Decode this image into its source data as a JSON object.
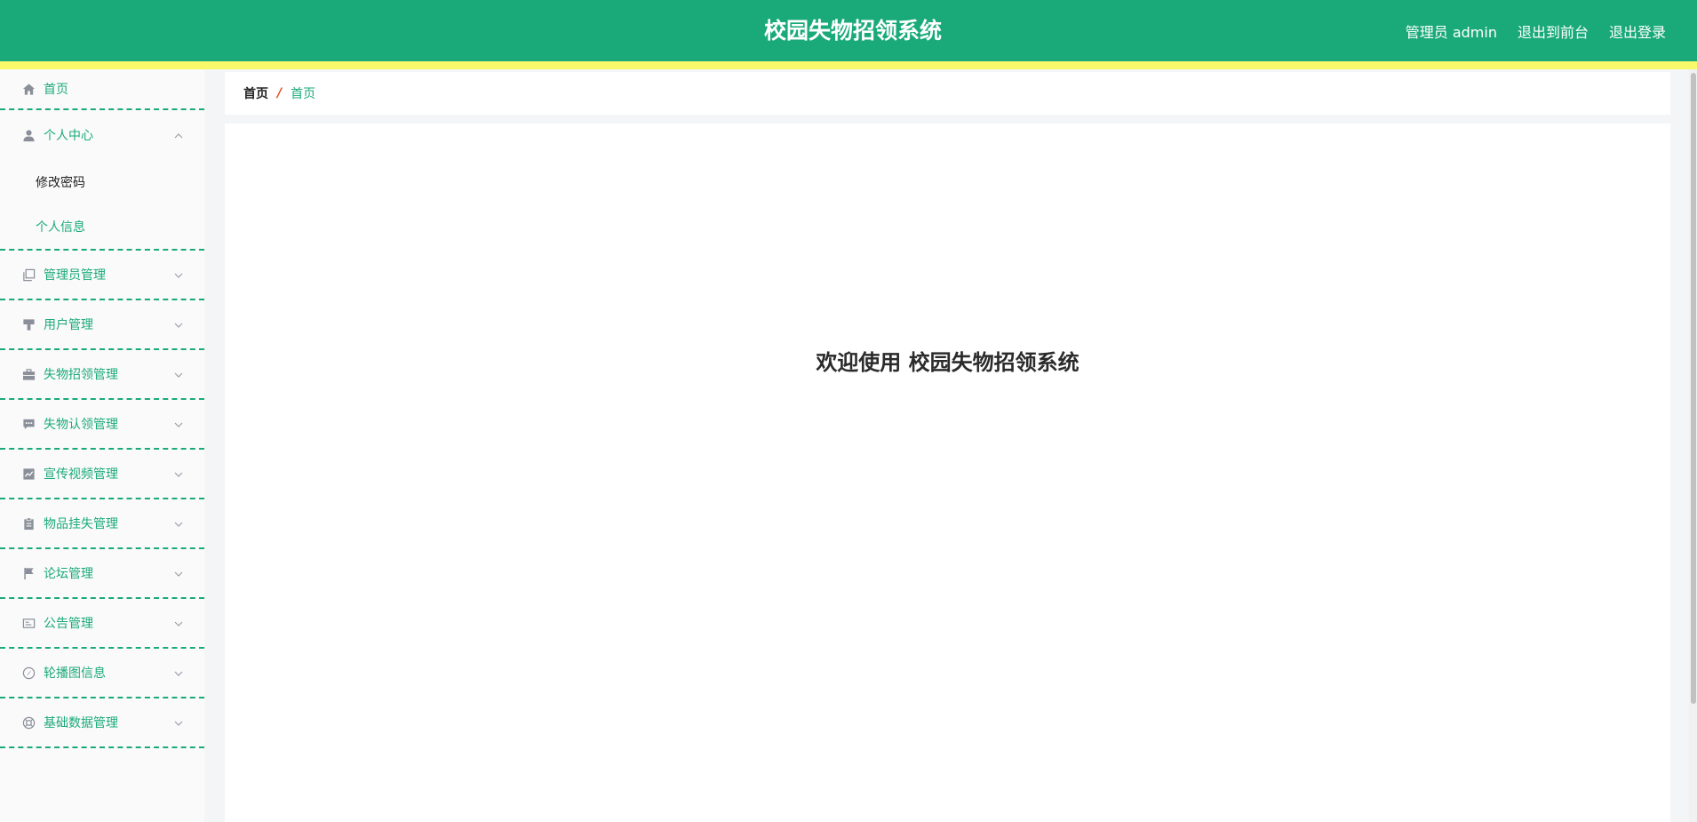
{
  "header": {
    "title": "校园失物招领系统",
    "user_label": "管理员 admin",
    "to_front": "退出到前台",
    "logout": "退出登录"
  },
  "sidebar": {
    "items": [
      {
        "label": "首页",
        "icon": "home-icon"
      },
      {
        "label": "个人中心",
        "icon": "user-icon",
        "expanded": true,
        "children": [
          {
            "label": "修改密码"
          },
          {
            "label": "个人信息"
          }
        ]
      },
      {
        "label": "管理员管理",
        "icon": "copy-icon"
      },
      {
        "label": "用户管理",
        "icon": "brush-icon"
      },
      {
        "label": "失物招领管理",
        "icon": "briefcase-icon"
      },
      {
        "label": "失物认领管理",
        "icon": "chat-icon"
      },
      {
        "label": "宣传视频管理",
        "icon": "chart-icon"
      },
      {
        "label": "物品挂失管理",
        "icon": "clipboard-icon"
      },
      {
        "label": "论坛管理",
        "icon": "flag-icon"
      },
      {
        "label": "公告管理",
        "icon": "notice-icon"
      },
      {
        "label": "轮播图信息",
        "icon": "compass-icon"
      },
      {
        "label": "基础数据管理",
        "icon": "lifebuoy-icon"
      }
    ]
  },
  "breadcrumb": {
    "home": "首页",
    "separator": "/",
    "current": "首页"
  },
  "main": {
    "welcome": "欢迎使用 校园失物招领系统"
  },
  "colors": {
    "brand": "#1aaa7a",
    "stripe": "#f7f86a",
    "separator": "#e8491d"
  }
}
